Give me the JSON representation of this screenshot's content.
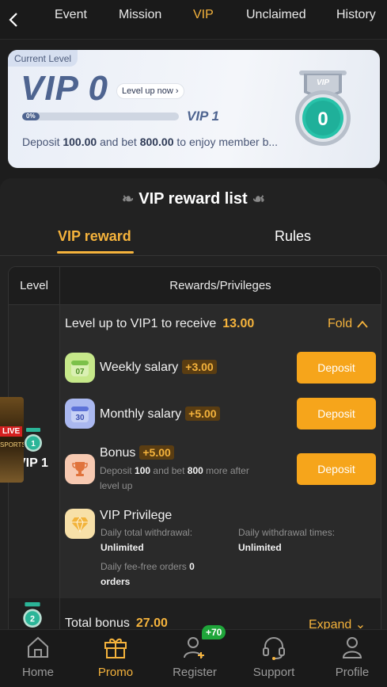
{
  "nav": {
    "tabs": [
      {
        "label": "Event"
      },
      {
        "label": "Mission"
      },
      {
        "label": "VIP"
      },
      {
        "label": "Unclaimed"
      },
      {
        "label": "History"
      }
    ],
    "active": "VIP"
  },
  "level_card": {
    "tag": "Current Level",
    "current": "VIP 0",
    "level_up_link": "Level up now",
    "progress_text": "0%",
    "progress_value": 0,
    "next": "VIP 1",
    "desc_pre": "Deposit ",
    "deposit_amount": "100.00",
    "desc_mid": " and bet ",
    "bet_amount": "800.00",
    "desc_post": " to enjoy member b...",
    "medal_number": "0",
    "medal_ribbon": "VIP"
  },
  "rewards": {
    "title": "VIP reward list",
    "tabs": [
      "VIP reward",
      "Rules"
    ],
    "table_headers": {
      "level": "Level",
      "rewards": "Rewards/Privileges"
    },
    "row1": {
      "level_label": "VIP 1",
      "level_badge": "1",
      "head_text": "Level up to VIP1 to receive",
      "head_amount": "13.00",
      "fold_label": "Fold",
      "items": [
        {
          "label": "Weekly salary",
          "badge": "+3.00",
          "button": "Deposit",
          "icon_text": "07"
        },
        {
          "label": "Monthly salary",
          "badge": "+5.00",
          "button": "Deposit",
          "icon_text": "30"
        },
        {
          "label": "Bonus",
          "badge": "+5.00",
          "button": "Deposit"
        }
      ],
      "bonus_desc": {
        "pre": "Deposit ",
        "dep": "100",
        "mid": " and bet ",
        "bet": "800",
        "post1": " more after",
        "post2": "level up"
      },
      "privilege": {
        "title": "VIP Privilege",
        "withdraw_label": "Daily total withdrawal:",
        "withdraw_value": "Unlimited",
        "times_label": "Daily withdrawal times:",
        "times_value": "Unlimited",
        "feefree_label": "Daily fee-free orders",
        "feefree_value": "0",
        "feefree_unit": "orders"
      }
    },
    "row2": {
      "level_badge": "2",
      "head_text": "Total bonus",
      "head_amount": "27.00",
      "expand_label": "Expand"
    }
  },
  "ad": {
    "live": "LIVE",
    "sports": "SPORTS"
  },
  "bottom_nav": {
    "items": [
      {
        "label": "Home"
      },
      {
        "label": "Promo"
      },
      {
        "label": "Register"
      },
      {
        "label": "Support"
      },
      {
        "label": "Profile"
      }
    ],
    "active": "Promo",
    "register_badge": "+70"
  },
  "colors": {
    "accent": "#f5b33c",
    "button": "#f6a51b",
    "card_text": "#4e6490"
  }
}
